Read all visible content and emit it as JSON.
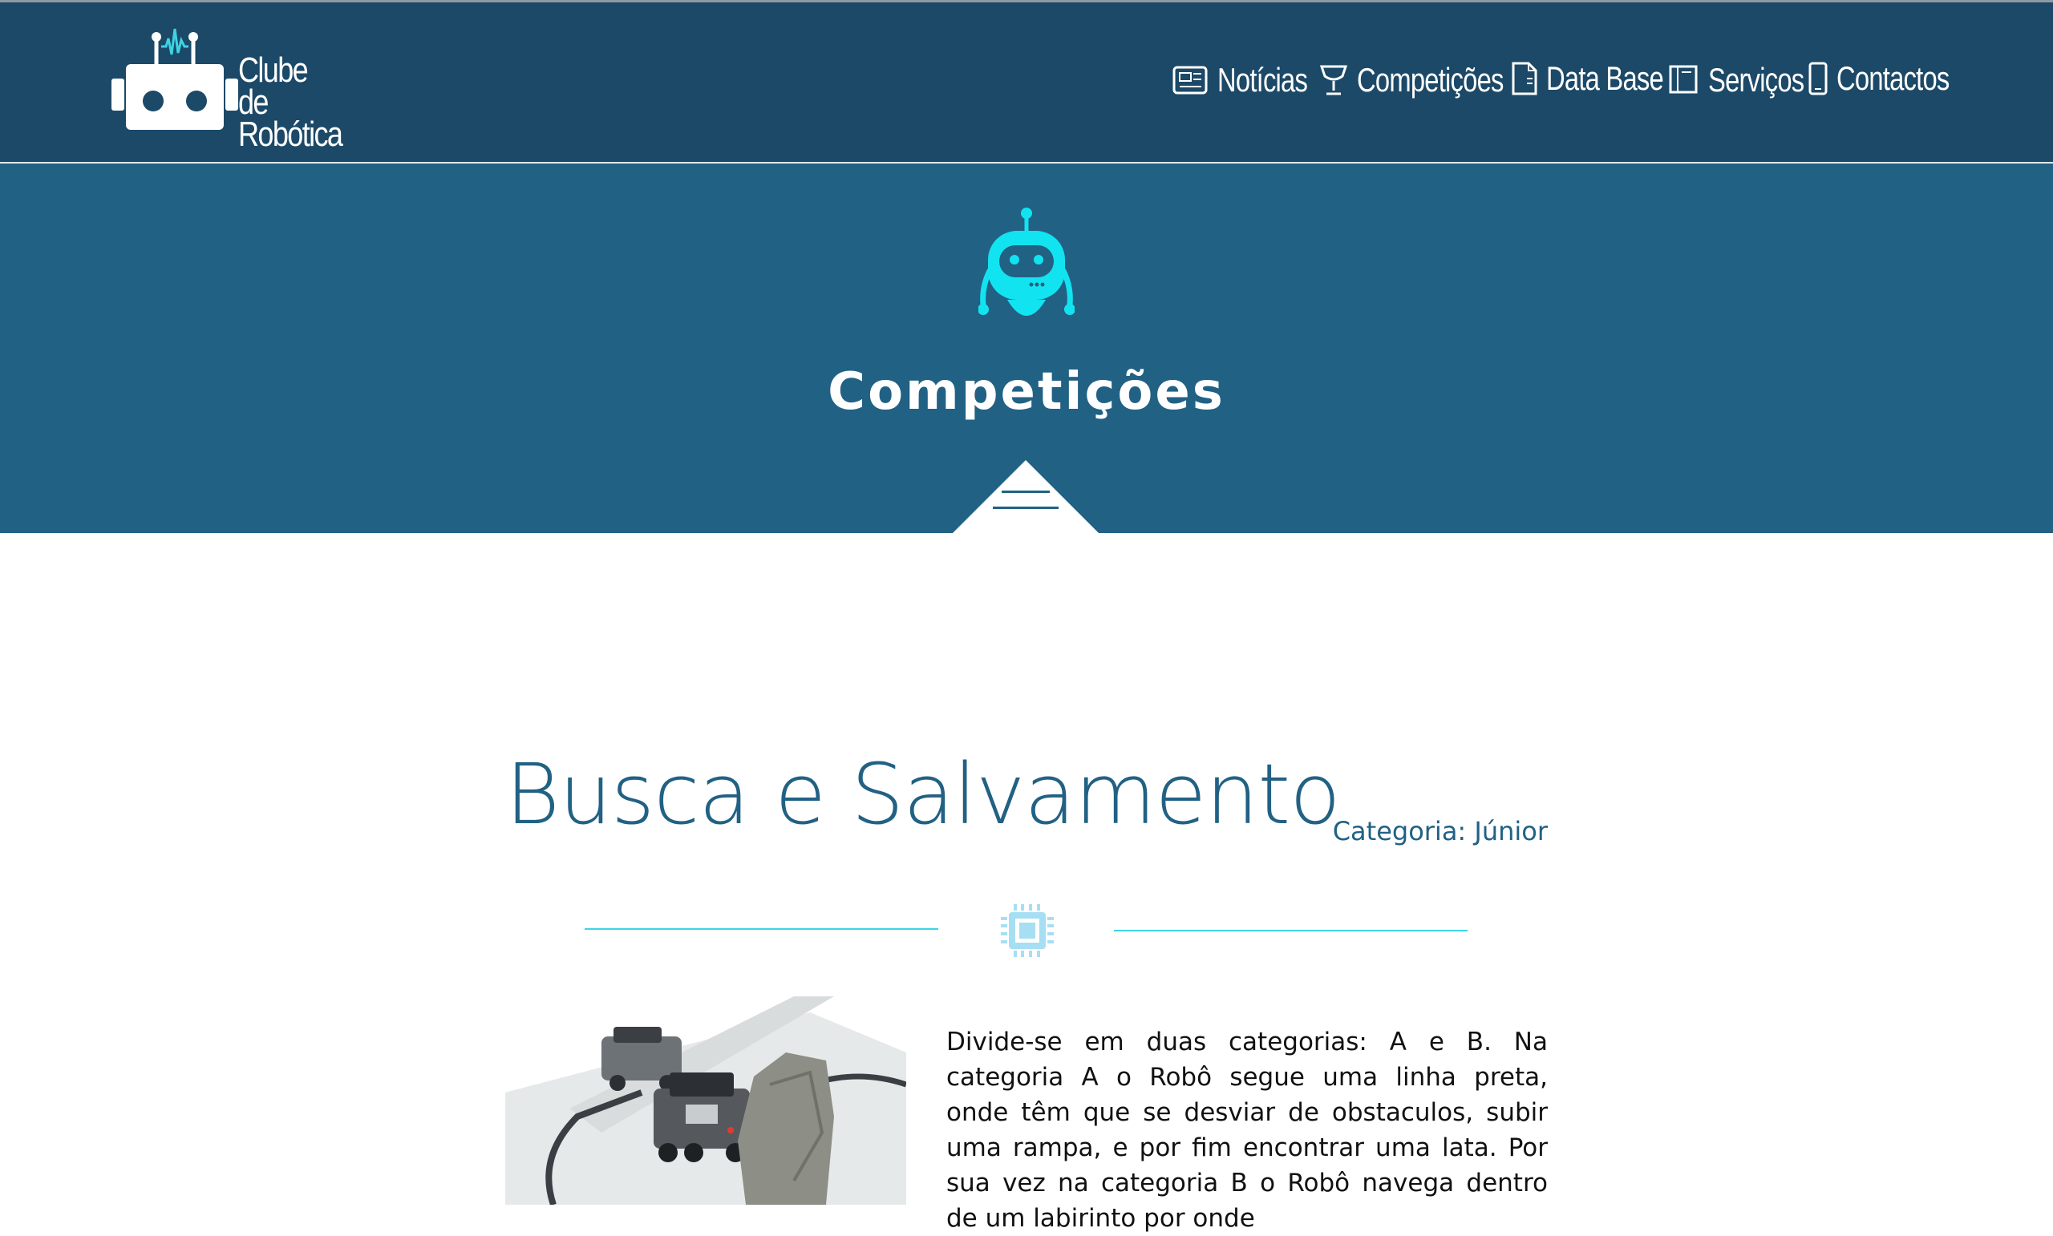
{
  "header": {
    "logo_line1": "Clube de",
    "logo_line2": "Robótica",
    "nav": [
      {
        "label": "Notícias",
        "icon": "newspaper-icon"
      },
      {
        "label": "Competições",
        "icon": "trophy-icon"
      },
      {
        "label": "Data Base",
        "icon": "document-icon"
      },
      {
        "label": "Serviços",
        "icon": "book-icon"
      },
      {
        "label": "Contactos",
        "icon": "mobile-phone-icon"
      }
    ]
  },
  "hero": {
    "title": "Competições",
    "icon": "robot-icon"
  },
  "section": {
    "title": "Busca e Salvamento",
    "category": "Categoria: Júnior",
    "divider_icon": "microchip-icon",
    "description": "Divide-se em duas categorias: A e B. Na categoria A o Robô segue uma linha preta, onde têm que se desviar de obstaculos, subir uma rampa, e por fim encontrar uma lata. Por sua vez na categoria B o Robô navega dentro de um labirinto por onde"
  },
  "colors": {
    "header_bg": "#1c4967",
    "hero_bg": "#216184",
    "accent_cyan": "#3dd3e4",
    "robot_cyan": "#12e3f0",
    "title_blue": "#216184"
  }
}
